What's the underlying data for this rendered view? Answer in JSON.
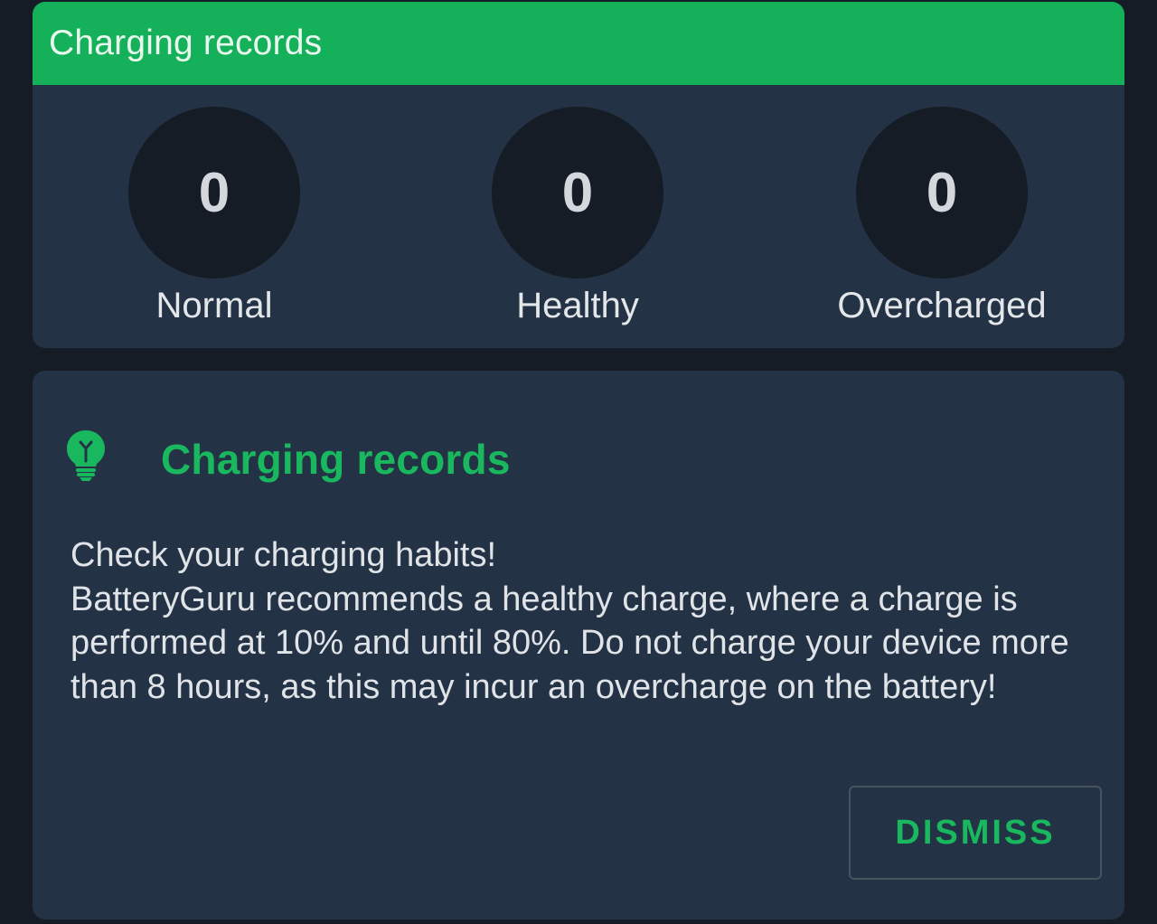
{
  "stats": {
    "header_title": "Charging records",
    "items": [
      {
        "label": "Normal",
        "value": "0"
      },
      {
        "label": "Healthy",
        "value": "0"
      },
      {
        "label": "Overcharged",
        "value": "0"
      }
    ]
  },
  "tip": {
    "icon": "lightbulb-icon",
    "title": "Charging records",
    "line1": "Check your charging habits!",
    "line2": "BatteryGuru recommends a healthy charge, where a charge is performed at 10% and until 80%. Do not charge your device more than 8 hours, as this may incur an overcharge on the battery!",
    "dismiss_label": "DISMISS"
  },
  "colors": {
    "accent": "#14b05a",
    "card": "#233345",
    "background": "#151c25"
  }
}
